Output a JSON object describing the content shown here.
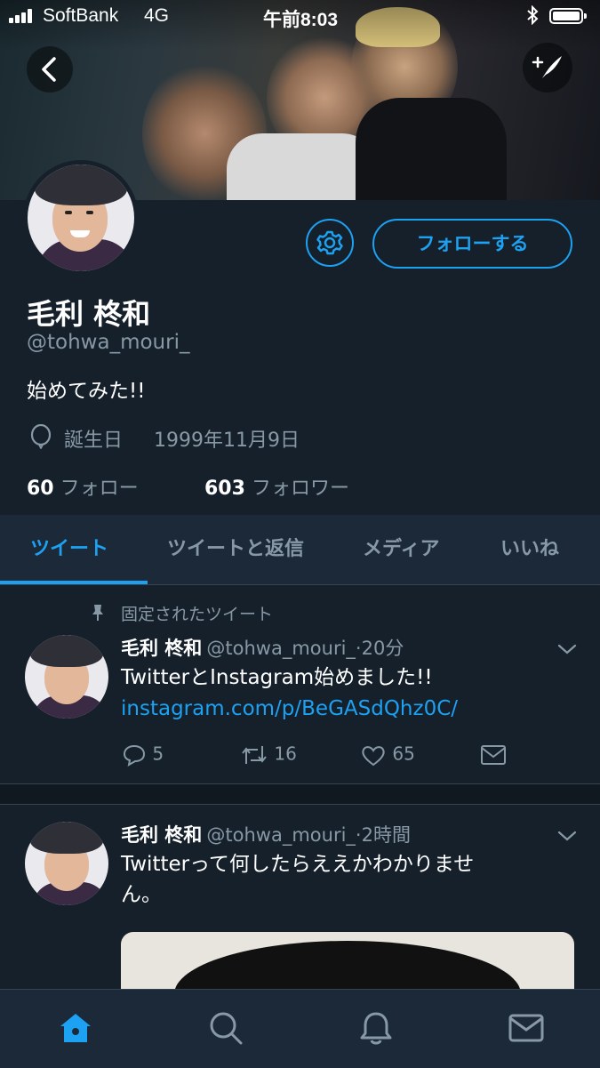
{
  "status_bar": {
    "carrier": "SoftBank",
    "network": "4G",
    "time": "午前8:03"
  },
  "profile": {
    "name": "毛利 柊和",
    "handle": "@tohwa_mouri_",
    "bio": "始めてみた!!",
    "birthday_label": "誕生日",
    "birthday_value": "1999年11月9日",
    "following_count": "60",
    "following_label": "フォロー",
    "followers_count": "603",
    "followers_label": "フォロワー",
    "follow_button": "フォローする"
  },
  "tabs": [
    {
      "label": "ツイート",
      "active": true
    },
    {
      "label": "ツイートと返信",
      "active": false
    },
    {
      "label": "メディア",
      "active": false
    },
    {
      "label": "いいね",
      "active": false
    }
  ],
  "pinned_label": "固定されたツイート",
  "tweets": [
    {
      "name": "毛利 柊和",
      "handle_time": "@tohwa_mouri_·20分",
      "text": "TwitterとInstagram始めました!!",
      "link": "instagram.com/p/BeGASdQhz0C/",
      "replies": "5",
      "retweets": "16",
      "likes": "65"
    },
    {
      "name": "毛利 柊和",
      "handle_time": "@tohwa_mouri_·2時間",
      "text_line1": "Twitterって何したらええかわかりませ",
      "text_line2": "ん。"
    }
  ],
  "colors": {
    "background": "#15202b",
    "accent": "#1da1f2",
    "secondary_text": "#8899a6"
  },
  "icons": [
    "back-arrow-icon",
    "compose-tweet-icon",
    "gear-icon",
    "birthday-balloon-icon",
    "pin-icon",
    "chevron-down-icon",
    "reply-icon",
    "retweet-icon",
    "like-icon",
    "dm-icon",
    "home-icon",
    "search-icon",
    "notifications-icon",
    "messages-icon"
  ]
}
